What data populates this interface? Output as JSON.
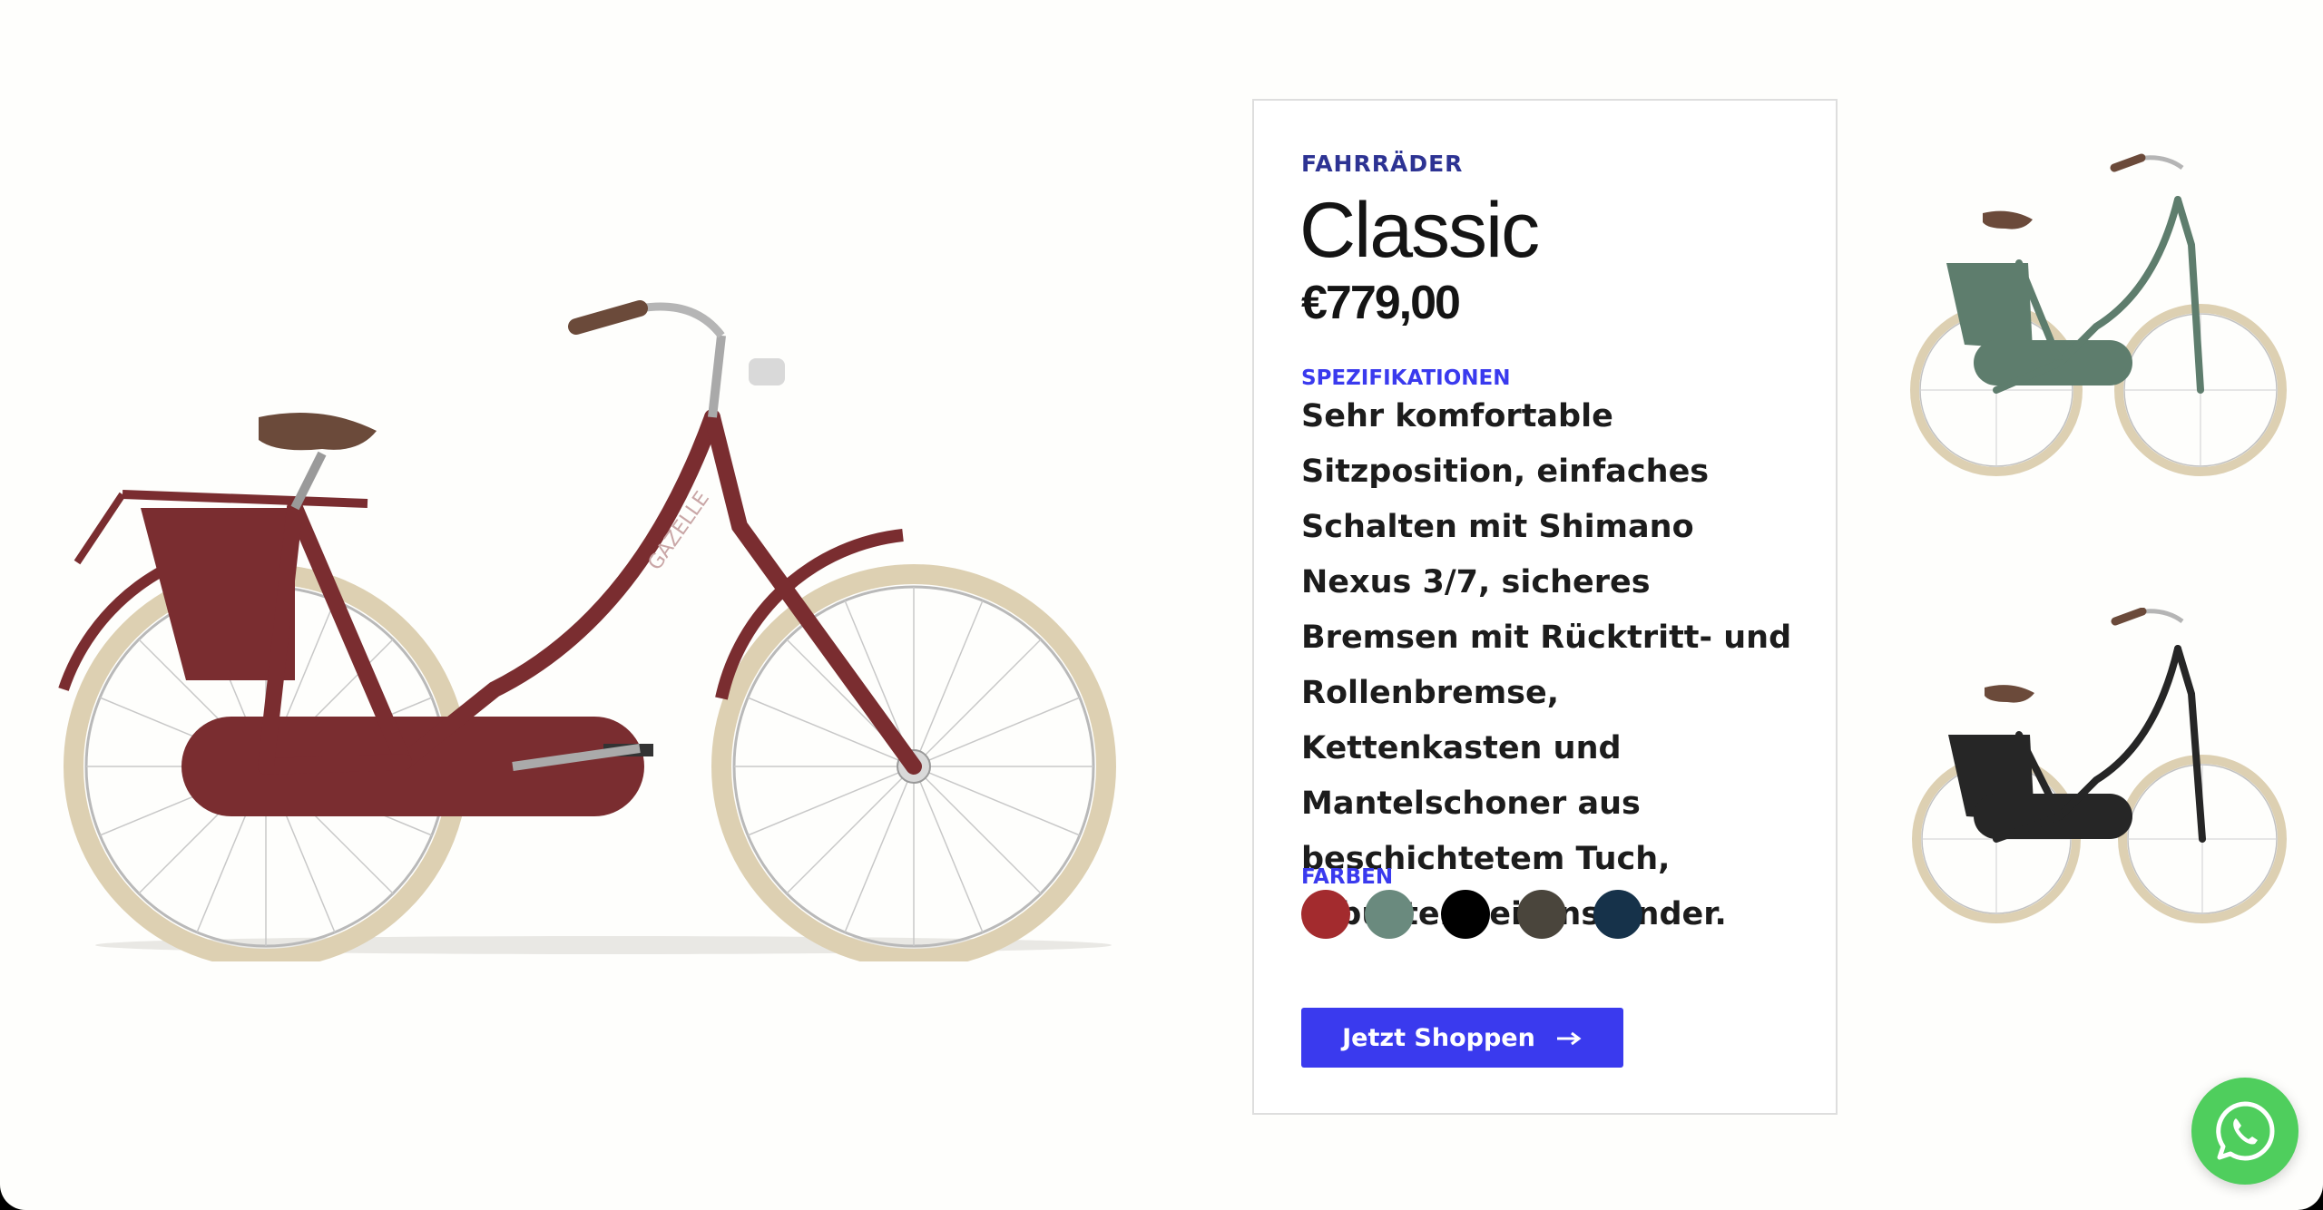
{
  "product": {
    "category": "FAHRRÄDER",
    "title": "Classic",
    "price": "€779,00",
    "specs_label": "SPEZIFIKATIONEN",
    "specs_text": "Sehr komfortable Sitzposition, einfaches Schalten mit Shimano Nexus 3/7, sicheres Bremsen mit Rücktritt- und Rollenbremse, Kettenkasten und Mantelschoner aus beschichtetem Tuch, robuster Seitenständer.",
    "colors_label": "FARBEN",
    "colors": [
      "#a32b2e",
      "#6a8a7e",
      "#000000",
      "#4a453c",
      "#16324a"
    ],
    "cta_label": "Jetzt Shoppen",
    "cta_icon": "arrow-right-icon"
  },
  "hero": {
    "bike_color": "#7a2d30",
    "tire_color": "#ddd0b2"
  },
  "thumbnails": [
    {
      "frame_color": "#5e7d6d",
      "tire_color": "#ddd0b2"
    },
    {
      "frame_color": "#262626",
      "tire_color": "#ddd0b2"
    }
  ],
  "chat_widget": {
    "icon": "whatsapp-icon",
    "color": "#4fce5d"
  }
}
